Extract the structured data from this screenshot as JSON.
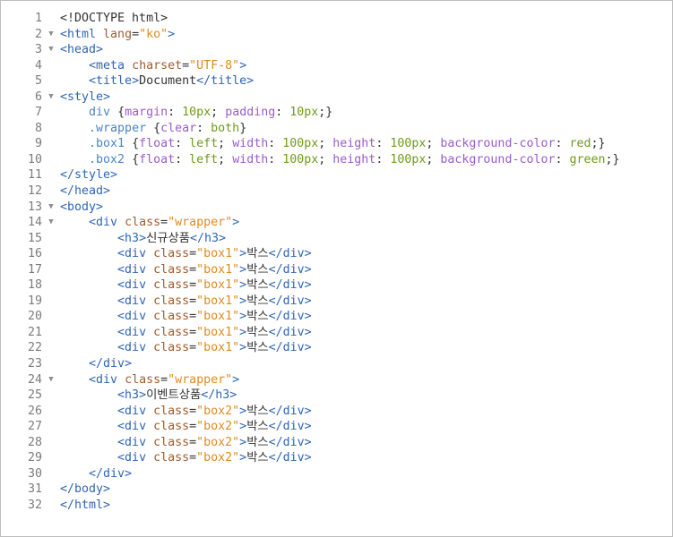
{
  "editor": {
    "lines": [
      {
        "n": "1",
        "fold": "",
        "segs": [
          [
            "txt",
            "<!DOCTYPE html>"
          ]
        ]
      },
      {
        "n": "2",
        "fold": "▼",
        "segs": [
          [
            "tag",
            "<html "
          ],
          [
            "attr",
            "lang"
          ],
          [
            "txt",
            "="
          ],
          [
            "str",
            "\"ko\""
          ],
          [
            "tag",
            ">"
          ]
        ]
      },
      {
        "n": "3",
        "fold": "▼",
        "segs": [
          [
            "tag",
            "<head>"
          ]
        ]
      },
      {
        "n": "4",
        "fold": "",
        "segs": [
          [
            "txt",
            "    "
          ],
          [
            "tag",
            "<meta "
          ],
          [
            "attr",
            "charset"
          ],
          [
            "txt",
            "="
          ],
          [
            "str",
            "\"UTF-8\""
          ],
          [
            "tag",
            ">"
          ]
        ]
      },
      {
        "n": "5",
        "fold": "",
        "segs": [
          [
            "txt",
            "    "
          ],
          [
            "tag",
            "<title>"
          ],
          [
            "txt",
            "Document"
          ],
          [
            "tag",
            "</title>"
          ]
        ]
      },
      {
        "n": "6",
        "fold": "▼",
        "segs": [
          [
            "tag",
            "<style>"
          ]
        ]
      },
      {
        "n": "7",
        "fold": "",
        "segs": [
          [
            "txt",
            "    "
          ],
          [
            "sel",
            "div "
          ],
          [
            "txt",
            "{"
          ],
          [
            "kw",
            "margin"
          ],
          [
            "txt",
            ": "
          ],
          [
            "num",
            "10px"
          ],
          [
            "txt",
            "; "
          ],
          [
            "kw",
            "padding"
          ],
          [
            "txt",
            ": "
          ],
          [
            "num",
            "10px"
          ],
          [
            "txt",
            ";}"
          ]
        ]
      },
      {
        "n": "8",
        "fold": "",
        "segs": [
          [
            "txt",
            "    "
          ],
          [
            "sel",
            ".wrapper "
          ],
          [
            "txt",
            "{"
          ],
          [
            "kw",
            "clear"
          ],
          [
            "txt",
            ": "
          ],
          [
            "val",
            "both"
          ],
          [
            "txt",
            "}"
          ]
        ]
      },
      {
        "n": "9",
        "fold": "",
        "segs": [
          [
            "txt",
            "    "
          ],
          [
            "sel",
            ".box1 "
          ],
          [
            "txt",
            "{"
          ],
          [
            "kw",
            "float"
          ],
          [
            "txt",
            ": "
          ],
          [
            "val",
            "left"
          ],
          [
            "txt",
            "; "
          ],
          [
            "kw",
            "width"
          ],
          [
            "txt",
            ": "
          ],
          [
            "num",
            "100px"
          ],
          [
            "txt",
            "; "
          ],
          [
            "kw",
            "height"
          ],
          [
            "txt",
            ": "
          ],
          [
            "num",
            "100px"
          ],
          [
            "txt",
            "; "
          ],
          [
            "kw",
            "background-color"
          ],
          [
            "txt",
            ": "
          ],
          [
            "val",
            "red"
          ],
          [
            "txt",
            ";}"
          ]
        ]
      },
      {
        "n": "10",
        "fold": "",
        "segs": [
          [
            "txt",
            "    "
          ],
          [
            "sel",
            ".box2 "
          ],
          [
            "txt",
            "{"
          ],
          [
            "kw",
            "float"
          ],
          [
            "txt",
            ": "
          ],
          [
            "val",
            "left"
          ],
          [
            "txt",
            "; "
          ],
          [
            "kw",
            "width"
          ],
          [
            "txt",
            ": "
          ],
          [
            "num",
            "100px"
          ],
          [
            "txt",
            "; "
          ],
          [
            "kw",
            "height"
          ],
          [
            "txt",
            ": "
          ],
          [
            "num",
            "100px"
          ],
          [
            "txt",
            "; "
          ],
          [
            "kw",
            "background-color"
          ],
          [
            "txt",
            ": "
          ],
          [
            "val",
            "green"
          ],
          [
            "txt",
            ";}"
          ]
        ]
      },
      {
        "n": "11",
        "fold": "",
        "segs": [
          [
            "tag",
            "</style>"
          ]
        ]
      },
      {
        "n": "12",
        "fold": "",
        "segs": [
          [
            "tag",
            "</head>"
          ]
        ]
      },
      {
        "n": "13",
        "fold": "▼",
        "segs": [
          [
            "tag",
            "<body>"
          ]
        ]
      },
      {
        "n": "14",
        "fold": "▼",
        "segs": [
          [
            "txt",
            "    "
          ],
          [
            "tag",
            "<div "
          ],
          [
            "attr",
            "class"
          ],
          [
            "txt",
            "="
          ],
          [
            "str",
            "\"wrapper\""
          ],
          [
            "tag",
            ">"
          ]
        ]
      },
      {
        "n": "15",
        "fold": "",
        "segs": [
          [
            "txt",
            "        "
          ],
          [
            "tag",
            "<h3>"
          ],
          [
            "txt",
            "신규상품"
          ],
          [
            "tag",
            "</h3>"
          ]
        ]
      },
      {
        "n": "16",
        "fold": "",
        "segs": [
          [
            "txt",
            "        "
          ],
          [
            "tag",
            "<div "
          ],
          [
            "attr",
            "class"
          ],
          [
            "txt",
            "="
          ],
          [
            "str",
            "\"box1\""
          ],
          [
            "tag",
            ">"
          ],
          [
            "txt",
            "박스"
          ],
          [
            "tag",
            "</div>"
          ]
        ]
      },
      {
        "n": "17",
        "fold": "",
        "segs": [
          [
            "txt",
            "        "
          ],
          [
            "tag",
            "<div "
          ],
          [
            "attr",
            "class"
          ],
          [
            "txt",
            "="
          ],
          [
            "str",
            "\"box1\""
          ],
          [
            "tag",
            ">"
          ],
          [
            "txt",
            "박스"
          ],
          [
            "tag",
            "</div>"
          ]
        ]
      },
      {
        "n": "18",
        "fold": "",
        "segs": [
          [
            "txt",
            "        "
          ],
          [
            "tag",
            "<div "
          ],
          [
            "attr",
            "class"
          ],
          [
            "txt",
            "="
          ],
          [
            "str",
            "\"box1\""
          ],
          [
            "tag",
            ">"
          ],
          [
            "txt",
            "박스"
          ],
          [
            "tag",
            "</div>"
          ]
        ]
      },
      {
        "n": "19",
        "fold": "",
        "segs": [
          [
            "txt",
            "        "
          ],
          [
            "tag",
            "<div "
          ],
          [
            "attr",
            "class"
          ],
          [
            "txt",
            "="
          ],
          [
            "str",
            "\"box1\""
          ],
          [
            "tag",
            ">"
          ],
          [
            "txt",
            "박스"
          ],
          [
            "tag",
            "</div>"
          ]
        ]
      },
      {
        "n": "20",
        "fold": "",
        "segs": [
          [
            "txt",
            "        "
          ],
          [
            "tag",
            "<div "
          ],
          [
            "attr",
            "class"
          ],
          [
            "txt",
            "="
          ],
          [
            "str",
            "\"box1\""
          ],
          [
            "tag",
            ">"
          ],
          [
            "txt",
            "박스"
          ],
          [
            "tag",
            "</div>"
          ]
        ]
      },
      {
        "n": "21",
        "fold": "",
        "segs": [
          [
            "txt",
            "        "
          ],
          [
            "tag",
            "<div "
          ],
          [
            "attr",
            "class"
          ],
          [
            "txt",
            "="
          ],
          [
            "str",
            "\"box1\""
          ],
          [
            "tag",
            ">"
          ],
          [
            "txt",
            "박스"
          ],
          [
            "tag",
            "</div>"
          ]
        ]
      },
      {
        "n": "22",
        "fold": "",
        "segs": [
          [
            "txt",
            "        "
          ],
          [
            "tag",
            "<div "
          ],
          [
            "attr",
            "class"
          ],
          [
            "txt",
            "="
          ],
          [
            "str",
            "\"box1\""
          ],
          [
            "tag",
            ">"
          ],
          [
            "txt",
            "박스"
          ],
          [
            "tag",
            "</div>"
          ]
        ]
      },
      {
        "n": "23",
        "fold": "",
        "segs": [
          [
            "txt",
            "    "
          ],
          [
            "tag",
            "</div>"
          ]
        ]
      },
      {
        "n": "24",
        "fold": "▼",
        "segs": [
          [
            "txt",
            "    "
          ],
          [
            "tag",
            "<div "
          ],
          [
            "attr",
            "class"
          ],
          [
            "txt",
            "="
          ],
          [
            "str",
            "\"wrapper\""
          ],
          [
            "tag",
            ">"
          ]
        ]
      },
      {
        "n": "25",
        "fold": "",
        "segs": [
          [
            "txt",
            "        "
          ],
          [
            "tag",
            "<h3>"
          ],
          [
            "txt",
            "이벤트상품"
          ],
          [
            "tag",
            "</h3>"
          ]
        ]
      },
      {
        "n": "26",
        "fold": "",
        "segs": [
          [
            "txt",
            "        "
          ],
          [
            "tag",
            "<div "
          ],
          [
            "attr",
            "class"
          ],
          [
            "txt",
            "="
          ],
          [
            "str",
            "\"box2\""
          ],
          [
            "tag",
            ">"
          ],
          [
            "txt",
            "박스"
          ],
          [
            "tag",
            "</div>"
          ]
        ]
      },
      {
        "n": "27",
        "fold": "",
        "segs": [
          [
            "txt",
            "        "
          ],
          [
            "tag",
            "<div "
          ],
          [
            "attr",
            "class"
          ],
          [
            "txt",
            "="
          ],
          [
            "str",
            "\"box2\""
          ],
          [
            "tag",
            ">"
          ],
          [
            "txt",
            "박스"
          ],
          [
            "tag",
            "</div>"
          ]
        ]
      },
      {
        "n": "28",
        "fold": "",
        "segs": [
          [
            "txt",
            "        "
          ],
          [
            "tag",
            "<div "
          ],
          [
            "attr",
            "class"
          ],
          [
            "txt",
            "="
          ],
          [
            "str",
            "\"box2\""
          ],
          [
            "tag",
            ">"
          ],
          [
            "txt",
            "박스"
          ],
          [
            "tag",
            "</div>"
          ]
        ]
      },
      {
        "n": "29",
        "fold": "",
        "segs": [
          [
            "txt",
            "        "
          ],
          [
            "tag",
            "<div "
          ],
          [
            "attr",
            "class"
          ],
          [
            "txt",
            "="
          ],
          [
            "str",
            "\"box2\""
          ],
          [
            "tag",
            ">"
          ],
          [
            "txt",
            "박스"
          ],
          [
            "tag",
            "</div>"
          ]
        ]
      },
      {
        "n": "30",
        "fold": "",
        "segs": [
          [
            "txt",
            "    "
          ],
          [
            "tag",
            "</div>"
          ]
        ]
      },
      {
        "n": "31",
        "fold": "",
        "segs": [
          [
            "tag",
            "</body>"
          ]
        ]
      },
      {
        "n": "32",
        "fold": "",
        "segs": [
          [
            "tag",
            "</html>"
          ]
        ]
      }
    ]
  },
  "colors": {
    "tag": "#2f65b5",
    "attribute": "#a05c2d",
    "string": "#e08a1e",
    "property": "#9b5cc9",
    "value": "#6f9a1b",
    "text": "#333333",
    "line_number": "#7b7b7b"
  }
}
